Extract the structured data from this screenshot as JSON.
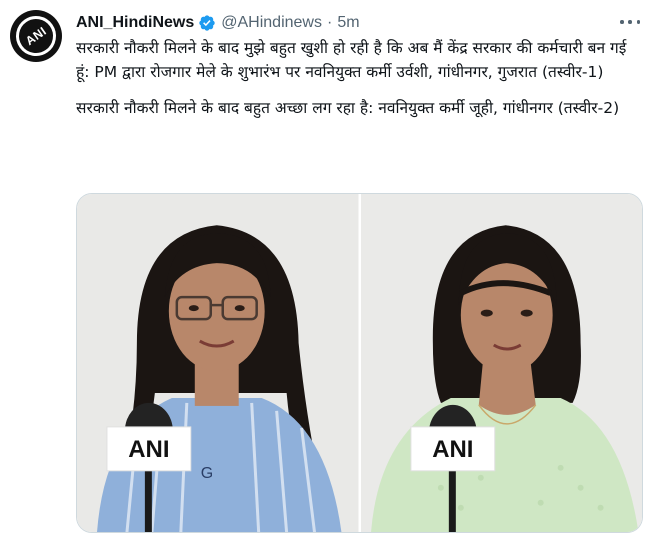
{
  "account": {
    "display_name": "ANI_HindiNews",
    "handle": "@AHindinews",
    "separator": "·",
    "time": "5m",
    "avatar_logo_text": "ANI"
  },
  "tweet": {
    "paragraph1": "सरकारी नौकरी मिलने के बाद मुझे बहुत खुशी हो रही है कि अब मैं केंद्र सरकार की कर्मचारी बन गई हूं: PM द्वारा रोजगार मेले के शुभारंभ पर नवनियुक्त कर्मी उर्वशी, गांधीनगर, गुजरात (तस्वीर-1)",
    "paragraph2": "सरकारी नौकरी मिलने के बाद बहुत अच्छा लग रहा है: नवनियुक्त कर्मी जूही, गांधीनगर (तस्वीर-2)"
  },
  "media": {
    "mic_logo_text": "ANI",
    "shirt_text": "G"
  },
  "colors": {
    "verified_blue": "#1d9bf0",
    "secondary_text": "#536471",
    "photo_background": "#e9e9e7",
    "shirt_blue": "#8fb0da",
    "kurta_green": "#cfe7c4",
    "hair": "#1b1512",
    "skin": "#b8876a"
  },
  "icons": {
    "verified": "verified-badge-icon",
    "more": "more-horizontal-icon"
  }
}
